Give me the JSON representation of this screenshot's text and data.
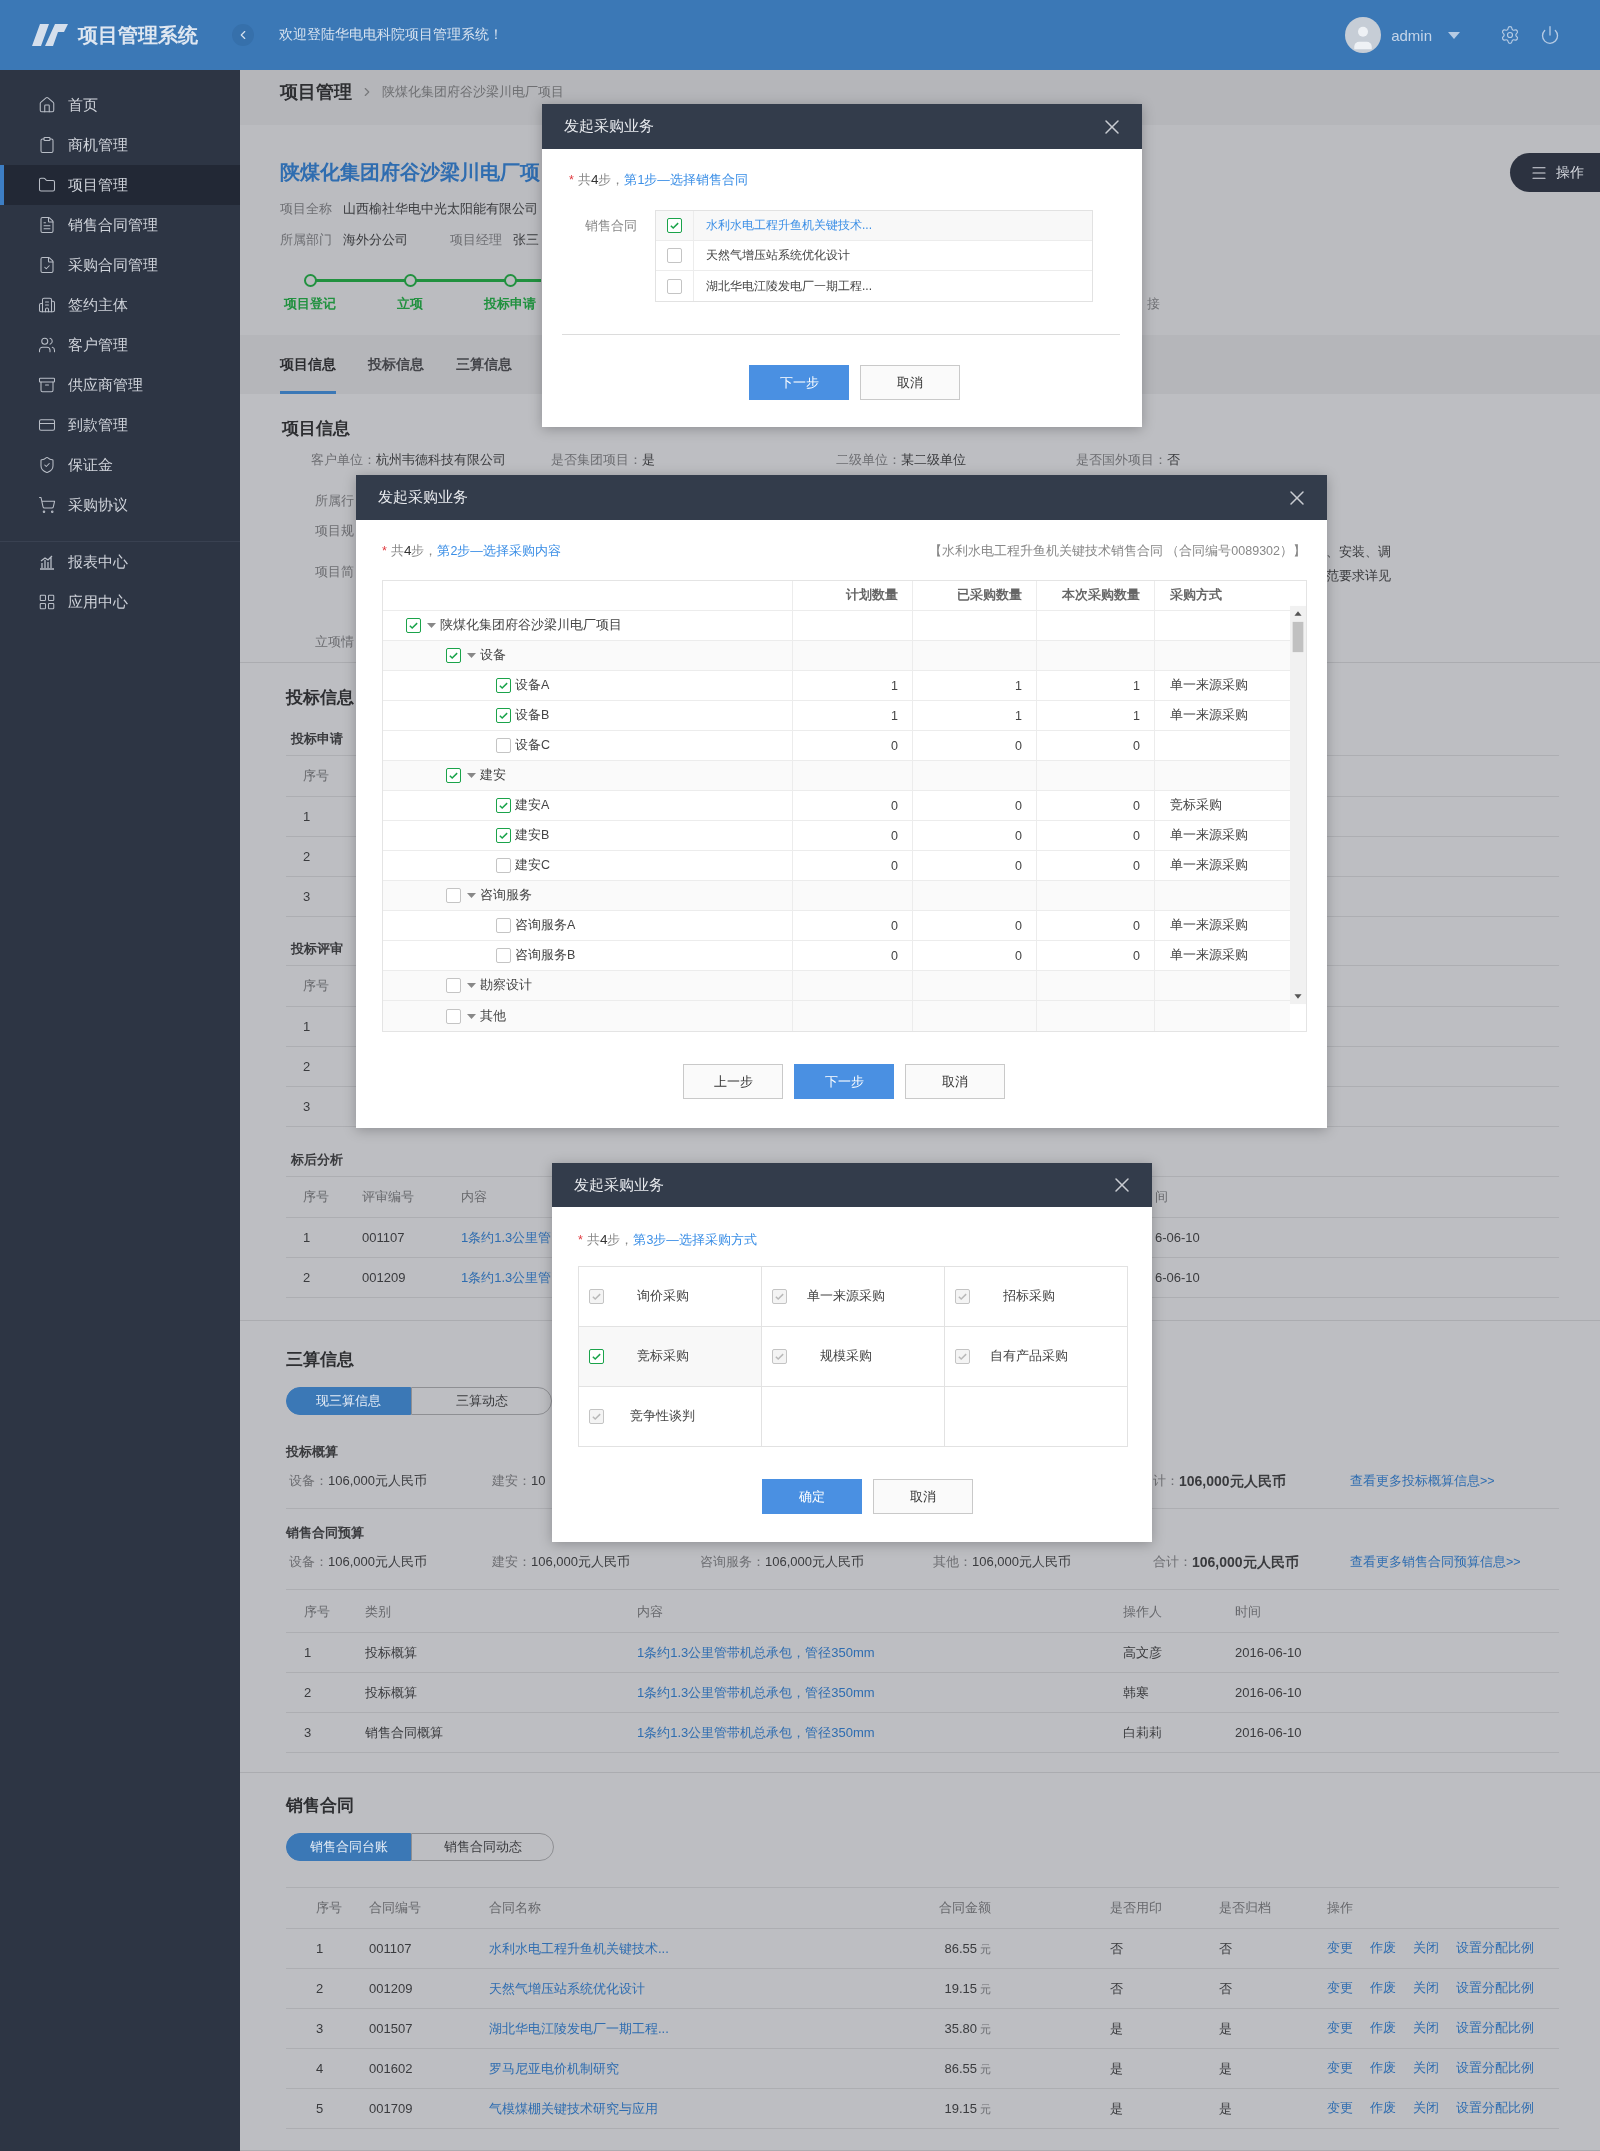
{
  "header": {
    "logo": "项目管理系统",
    "welcome": "欢迎登陆华电电科院项目管理系统！",
    "user": "admin"
  },
  "sidebar": {
    "groups": [
      {
        "items": [
          {
            "label": "首页",
            "selected": false
          },
          {
            "label": "商机管理",
            "selected": false
          },
          {
            "label": "项目管理",
            "selected": true
          },
          {
            "label": "销售合同管理",
            "selected": false
          },
          {
            "label": "采购合同管理",
            "selected": false
          },
          {
            "label": "签约主体",
            "selected": false
          },
          {
            "label": "客户管理",
            "selected": false
          },
          {
            "label": "供应商管理",
            "selected": false
          },
          {
            "label": "到款管理",
            "selected": false
          },
          {
            "label": "保证金",
            "selected": false
          },
          {
            "label": "采购协议",
            "selected": false
          }
        ]
      },
      {
        "items": [
          {
            "label": "报表中心",
            "selected": false
          },
          {
            "label": "应用中心",
            "selected": false
          }
        ]
      }
    ]
  },
  "breadcrumb": {
    "section": "项目管理",
    "current": "陕煤化集团府谷沙梁川电厂项目"
  },
  "actions_button": "操作",
  "project": {
    "title": "陕煤化集团府谷沙梁川电厂项",
    "lines": [
      [
        {
          "label": "项目全称",
          "value": "山西榆社华电中光太阳能有限公司"
        }
      ],
      [
        {
          "label": "所属部门",
          "value": "海外分公司"
        },
        {
          "label": "项目经理",
          "value": "张三"
        }
      ]
    ],
    "steps": [
      {
        "label": "项目登记",
        "done": true
      },
      {
        "label": "立项",
        "done": true
      },
      {
        "label": "投标申请",
        "done": true
      },
      {
        "label": "接",
        "done": false
      }
    ]
  },
  "tabs": [
    {
      "label": "项目信息",
      "selected": true
    },
    {
      "label": "投标信息",
      "selected": false
    },
    {
      "label": "三算信息",
      "selected": false
    }
  ],
  "project_info": {
    "heading": "项目信息",
    "fields": [
      {
        "label": "客户单位：",
        "value": "杭州韦德科技有限公司"
      },
      {
        "label": "是否集团项目：",
        "value": "是"
      },
      {
        "label": "二级单位：",
        "value": "某二级单位"
      },
      {
        "label": "是否国外项目：",
        "value": "否"
      }
    ],
    "cut_labels": [
      "所属行",
      "项目规",
      "项目简",
      "立项情"
    ],
    "cut_texts": [
      "、安装、调",
      "范要求详见"
    ]
  },
  "bidding": {
    "heading": "投标信息",
    "tables": [
      {
        "title": "投标申请",
        "columns": [
          "序号"
        ],
        "rows": [
          [
            "1"
          ],
          [
            "2"
          ],
          [
            "3"
          ]
        ]
      },
      {
        "title": "投标评审",
        "columns": [
          "序号"
        ],
        "rows": [
          [
            "1"
          ],
          [
            "2"
          ],
          [
            "3"
          ]
        ]
      },
      {
        "title": "标后分析",
        "columns": [
          "序号",
          "评审编号",
          "内容",
          "间"
        ],
        "rows": [
          [
            "1",
            "001107",
            "1条约1.3公里管",
            "6-06-10"
          ],
          [
            "2",
            "001209",
            "1条约1.3公里管",
            "6-06-10"
          ]
        ]
      }
    ]
  },
  "estimates": {
    "heading": "三算信息",
    "toggle": [
      {
        "label": "现三算信息",
        "selected": true
      },
      {
        "label": "三算动态",
        "selected": false
      }
    ],
    "groups": [
      {
        "title": "投标概算",
        "items": [
          {
            "label": "设备：",
            "value": "106,000元人民币"
          },
          {
            "label": "建安：",
            "value": "10"
          },
          {
            "label": "计：",
            "value": "106,000元人民币"
          }
        ],
        "link": "查看更多投标概算信息>>"
      },
      {
        "title": "销售合同预算",
        "items": [
          {
            "label": "设备：",
            "value": "106,000元人民币"
          },
          {
            "label": "建安：",
            "value": "106,000元人民币"
          },
          {
            "label": "咨询服务：",
            "value": "106,000元人民币"
          },
          {
            "label": "其他：",
            "value": "106,000元人民币"
          },
          {
            "label": "合计：",
            "value": "106,000元人民币"
          }
        ],
        "link": "查看更多销售合同预算信息>>"
      }
    ],
    "table": {
      "columns": [
        "序号",
        "类别",
        "内容",
        "操作人",
        "时间"
      ],
      "rows": [
        [
          "1",
          "投标概算",
          "1条约1.3公里管带机总承包，管径350mm",
          "高文彦",
          "2016-06-10"
        ],
        [
          "2",
          "投标概算",
          "1条约1.3公里管带机总承包，管径350mm",
          "韩寒",
          "2016-06-10"
        ],
        [
          "3",
          "销售合同概算",
          "1条约1.3公里管带机总承包，管径350mm",
          "白莉莉",
          "2016-06-10"
        ]
      ]
    }
  },
  "sales": {
    "heading": "销售合同",
    "toggle": [
      {
        "label": "销售合同台账",
        "selected": true
      },
      {
        "label": "销售合同动态",
        "selected": false
      }
    ],
    "columns": [
      "序号",
      "合同编号",
      "合同名称",
      "合同金额",
      "是否用印",
      "是否归档",
      "操作"
    ],
    "rows": [
      {
        "no": "1",
        "code": "001107",
        "name": "水利水电工程升鱼机关键技术...",
        "amount": "86.55",
        "unit": "元",
        "sealed": "否",
        "archived": "否",
        "actions": [
          "变更",
          "作废",
          "关闭",
          "设置分配比例"
        ]
      },
      {
        "no": "2",
        "code": "001209",
        "name": "天然气增压站系统优化设计",
        "amount": "19.15",
        "unit": "元",
        "sealed": "否",
        "archived": "否",
        "actions": [
          "变更",
          "作废",
          "关闭",
          "设置分配比例"
        ]
      },
      {
        "no": "3",
        "code": "001507",
        "name": "湖北华电江陵发电厂一期工程...",
        "amount": "35.80",
        "unit": "元",
        "sealed": "是",
        "archived": "是",
        "actions": [
          "变更",
          "作废",
          "关闭",
          "设置分配比例"
        ]
      },
      {
        "no": "4",
        "code": "001602",
        "name": "罗马尼亚电价机制研究",
        "amount": "86.55",
        "unit": "元",
        "sealed": "是",
        "archived": "是",
        "actions": [
          "变更",
          "作废",
          "关闭",
          "设置分配比例"
        ]
      },
      {
        "no": "5",
        "code": "001709",
        "name": "气模煤棚关键技术研究与应用",
        "amount": "19.15",
        "unit": "元",
        "sealed": "是",
        "archived": "是",
        "actions": [
          "变更",
          "作废",
          "关闭",
          "设置分配比例"
        ]
      }
    ]
  },
  "modals": [
    {
      "kind": "contracts",
      "title": "发起采购业务",
      "step": {
        "mark": "*",
        "count": "共**4**步，",
        "title": "第1步—选择销售合同"
      },
      "field_label": "销售合同",
      "options": [
        {
          "label": "水利水电工程升鱼机关键技术...",
          "checked": true
        },
        {
          "label": "天然气增压站系统优化设计",
          "checked": false
        },
        {
          "label": "湖北华电江陵发电厂一期工程...",
          "checked": false
        }
      ],
      "buttons": [
        {
          "label": "下一步",
          "primary": true
        },
        {
          "label": "取消",
          "primary": false
        }
      ]
    },
    {
      "kind": "contents",
      "title": "发起采购业务",
      "step": {
        "mark": "*",
        "count": "共**4**步，",
        "title": "第2步—选择采购内容"
      },
      "note": "【水利水电工程升鱼机关键技术销售合同 （合同编号0089302）】",
      "columns": [
        "计划数量",
        "已采购数量",
        "本次采购数量",
        "采购方式"
      ],
      "tree": [
        {
          "label": "陕煤化集团府谷沙梁川电厂项目",
          "checked": true,
          "expanded": true,
          "children": [
            {
              "label": "设备",
              "checked": true,
              "expanded": true,
              "children": [
                {
                  "label": "设备A",
                  "checked": true,
                  "values": [
                    "1",
                    "1",
                    "1",
                    "单一来源采购"
                  ]
                },
                {
                  "label": "设备B",
                  "checked": true,
                  "values": [
                    "1",
                    "1",
                    "1",
                    "单一来源采购"
                  ]
                },
                {
                  "label": "设备C",
                  "checked": false,
                  "values": [
                    "0",
                    "0",
                    "0"
                  ]
                }
              ]
            },
            {
              "label": "建安",
              "checked": true,
              "expanded": true,
              "children": [
                {
                  "label": "建安A",
                  "checked": true,
                  "values": [
                    "0",
                    "0",
                    "0",
                    "竞标采购"
                  ]
                },
                {
                  "label": "建安B",
                  "checked": true,
                  "values": [
                    "0",
                    "0",
                    "0",
                    "单一来源采购"
                  ]
                },
                {
                  "label": "建安C",
                  "checked": false,
                  "values": [
                    "0",
                    "0",
                    "0",
                    "单一来源采购"
                  ]
                }
              ]
            },
            {
              "label": "咨询服务",
              "checked": false,
              "expanded": true,
              "children": [
                {
                  "label": "咨询服务A",
                  "checked": false,
                  "values": [
                    "0",
                    "0",
                    "0",
                    "单一来源采购"
                  ]
                },
                {
                  "label": "咨询服务B",
                  "checked": false,
                  "values": [
                    "0",
                    "0",
                    "0",
                    "单一来源采购"
                  ]
                }
              ]
            },
            {
              "label": "勘察设计",
              "checked": false,
              "expanded": true
            },
            {
              "label": "其他",
              "checked": false,
              "expanded": true
            }
          ]
        }
      ],
      "buttons": [
        {
          "label": "上一步",
          "primary": false
        },
        {
          "label": "下一步",
          "primary": true
        },
        {
          "label": "取消",
          "primary": false
        }
      ]
    },
    {
      "kind": "methods",
      "title": "发起采购业务",
      "step": {
        "mark": "*",
        "count": "共**4**步，",
        "title": "第3步—选择采购方式"
      },
      "options": [
        {
          "label": "询价采购",
          "checked": true,
          "disabled": true
        },
        {
          "label": "单一来源采购",
          "checked": true,
          "disabled": true
        },
        {
          "label": "招标采购",
          "checked": true,
          "disabled": true
        },
        {
          "label": "竞标采购",
          "checked": true,
          "disabled": false
        },
        {
          "label": "规模采购",
          "checked": true,
          "disabled": true
        },
        {
          "label": "自有产品采购",
          "checked": true,
          "disabled": true
        },
        {
          "label": "竞争性谈判",
          "checked": true,
          "disabled": true
        }
      ],
      "buttons": [
        {
          "label": "确定",
          "primary": true
        },
        {
          "label": "取消",
          "primary": false
        }
      ]
    }
  ]
}
